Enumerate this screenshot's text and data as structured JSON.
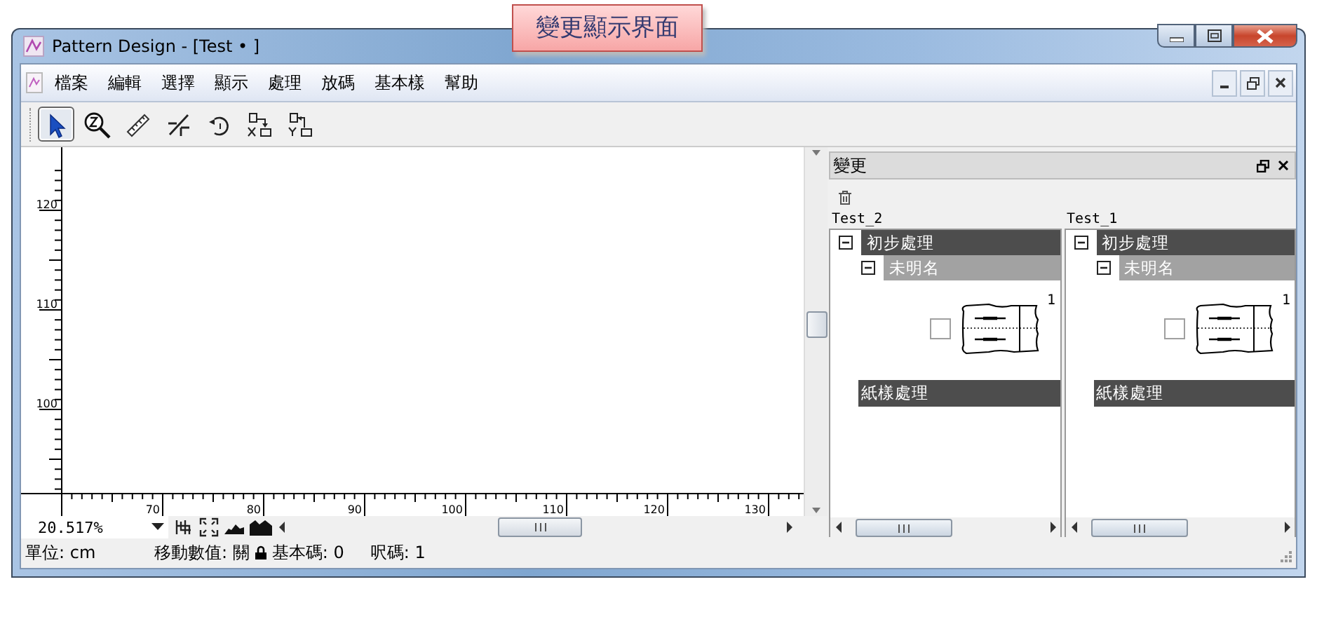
{
  "callout": "變更顯示界面",
  "window": {
    "title": "Pattern Design - [Test • ]"
  },
  "menu": [
    "檔案",
    "編輯",
    "選擇",
    "顯示",
    "處理",
    "放碼",
    "基本樣",
    "幫助"
  ],
  "tools": [
    {
      "kind": "pointer",
      "selected": true
    },
    {
      "kind": "zoom",
      "selected": false
    },
    {
      "kind": "ruler",
      "selected": false
    },
    {
      "kind": "cut",
      "selected": false
    },
    {
      "kind": "rotate",
      "selected": false
    },
    {
      "kind": "flipx",
      "selected": false
    },
    {
      "kind": "flipy",
      "selected": false
    }
  ],
  "canvas": {
    "v_ruler": [
      "120",
      "110",
      "100"
    ],
    "h_ruler": [
      "70",
      "80",
      "90",
      "100",
      "110",
      "120",
      "130"
    ]
  },
  "zoom": {
    "value": "20.517%"
  },
  "panel": {
    "title": "變更",
    "columns": [
      {
        "name": "Test_2",
        "group": "初步處理",
        "subgroup": "未明名",
        "count": "1",
        "checked": false,
        "footer": "紙樣處理"
      },
      {
        "name": "Test_1",
        "group": "初步處理",
        "subgroup": "未明名",
        "count": "1",
        "checked": false,
        "footer": "紙樣處理"
      }
    ]
  },
  "status": {
    "unit": "單位: cm",
    "move": "移動數值: 關",
    "base": "基本碼: 0",
    "size": "呎碼: 1"
  }
}
